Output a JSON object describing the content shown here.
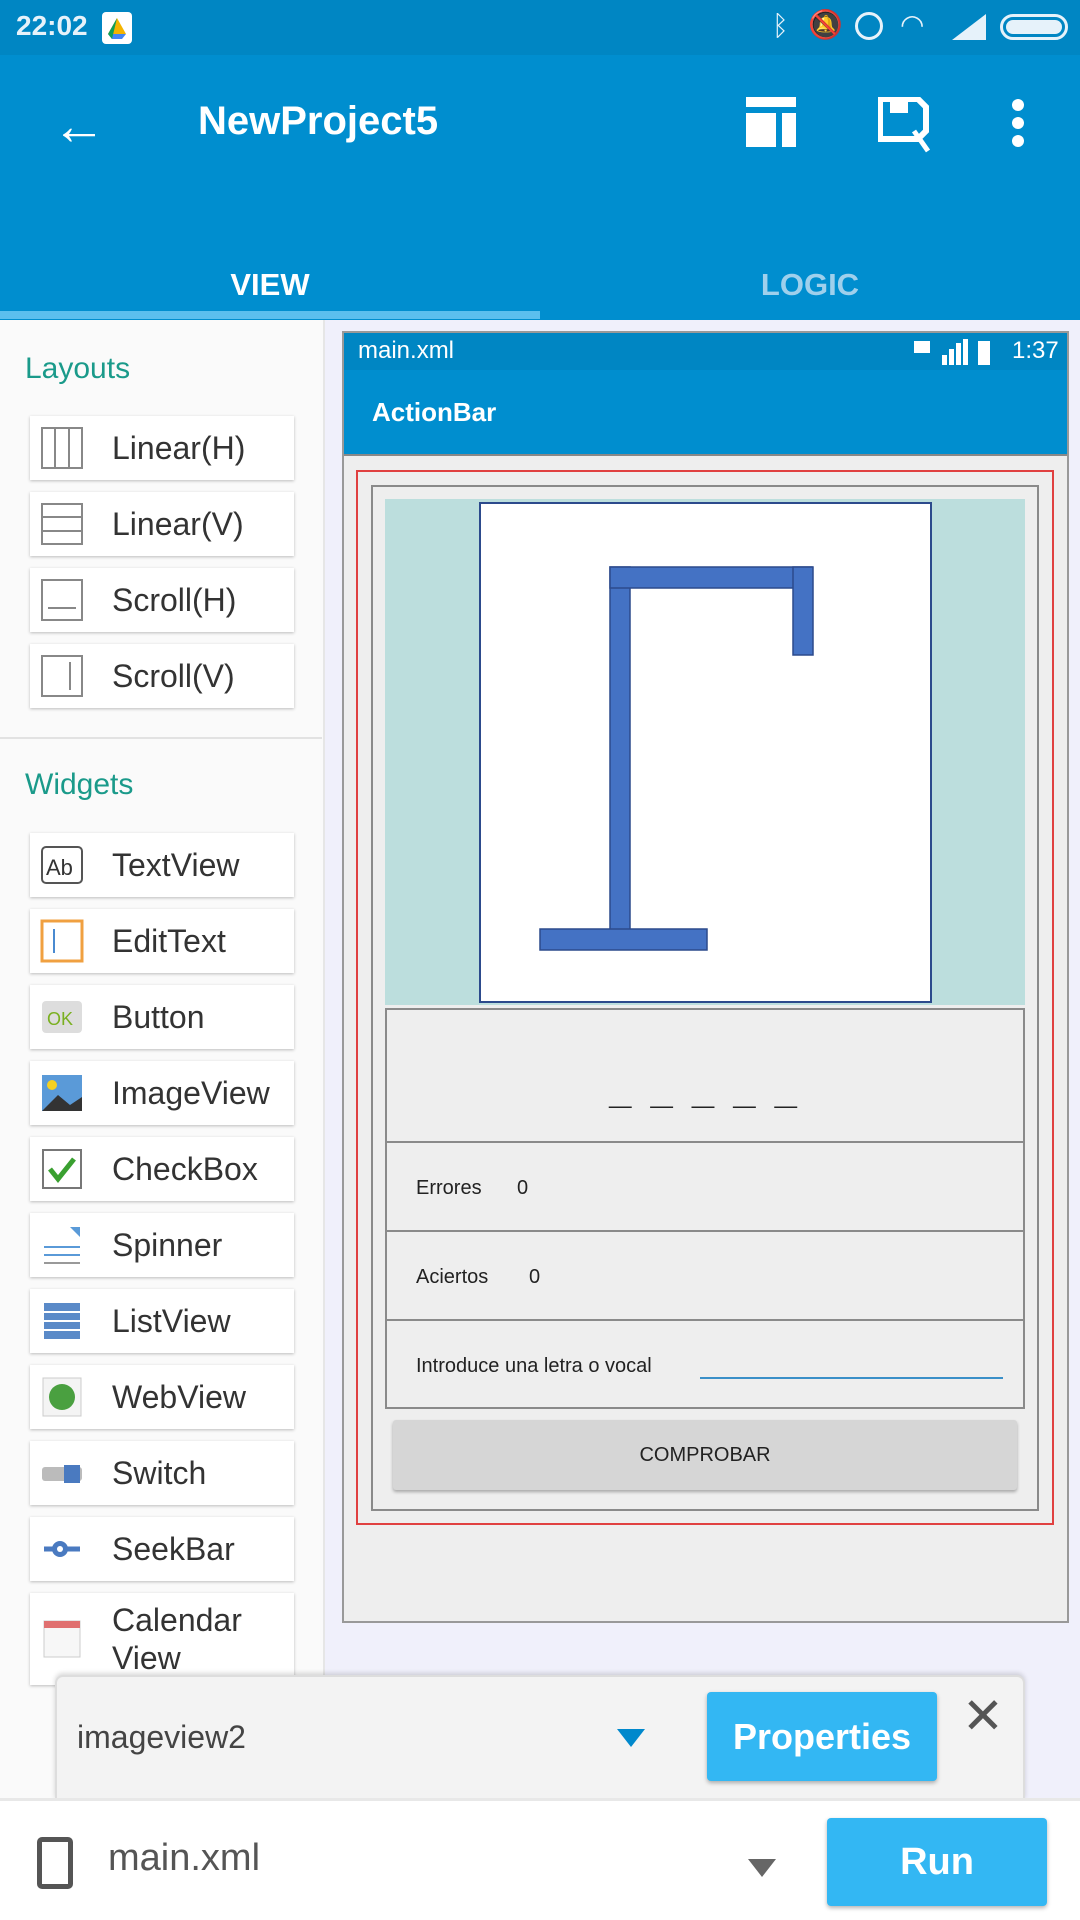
{
  "status_bar": {
    "time": "22:02",
    "icons": [
      "drive-icon",
      "bluetooth-icon",
      "muted-icon",
      "alarm-icon",
      "wifi-icon",
      "signal-icon",
      "battery-icon"
    ]
  },
  "app_bar": {
    "title": "NewProject5",
    "icons": [
      "back-arrow-icon",
      "layout-icon",
      "save-icon",
      "more-vert-icon"
    ]
  },
  "tabs": [
    {
      "label": "VIEW",
      "active": true
    },
    {
      "label": "LOGIC",
      "active": false
    }
  ],
  "sidebar": {
    "layouts_title": "Layouts",
    "layouts": [
      {
        "label": "Linear(H)",
        "icon": "linear-h-icon"
      },
      {
        "label": "Linear(V)",
        "icon": "linear-v-icon"
      },
      {
        "label": "Scroll(H)",
        "icon": "scroll-h-icon"
      },
      {
        "label": "Scroll(V)",
        "icon": "scroll-v-icon"
      }
    ],
    "widgets_title": "Widgets",
    "widgets": [
      {
        "label": "TextView",
        "icon": "textview-icon"
      },
      {
        "label": "EditText",
        "icon": "edittext-icon"
      },
      {
        "label": "Button",
        "icon": "button-icon"
      },
      {
        "label": "ImageView",
        "icon": "imageview-icon"
      },
      {
        "label": "CheckBox",
        "icon": "checkbox-icon"
      },
      {
        "label": "Spinner",
        "icon": "spinner-icon"
      },
      {
        "label": "ListView",
        "icon": "listview-icon"
      },
      {
        "label": "WebView",
        "icon": "webview-icon"
      },
      {
        "label": "Switch",
        "icon": "switch-icon"
      },
      {
        "label": "SeekBar",
        "icon": "seekbar-icon"
      },
      {
        "label": "Calendar View",
        "icon": "calendar-icon"
      }
    ]
  },
  "preview": {
    "status_title": "main.xml",
    "status_time": "1:37",
    "actionbar": "ActionBar",
    "word": "_ _ _ _ _",
    "errores_label": "Errores",
    "errores_value": "0",
    "aciertos_label": "Aciertos",
    "aciertos_value": "0",
    "input_label": "Introduce una letra o vocal",
    "button": "COMPROBAR"
  },
  "selection_panel": {
    "selected": "imageview2",
    "properties": "Properties"
  },
  "bottom_bar": {
    "file": "main.xml",
    "run": "Run"
  },
  "colors": {
    "primary": "#008ecf",
    "accent": "#33b7f3",
    "gallows": "#4472c4",
    "selection": "#e04040"
  }
}
